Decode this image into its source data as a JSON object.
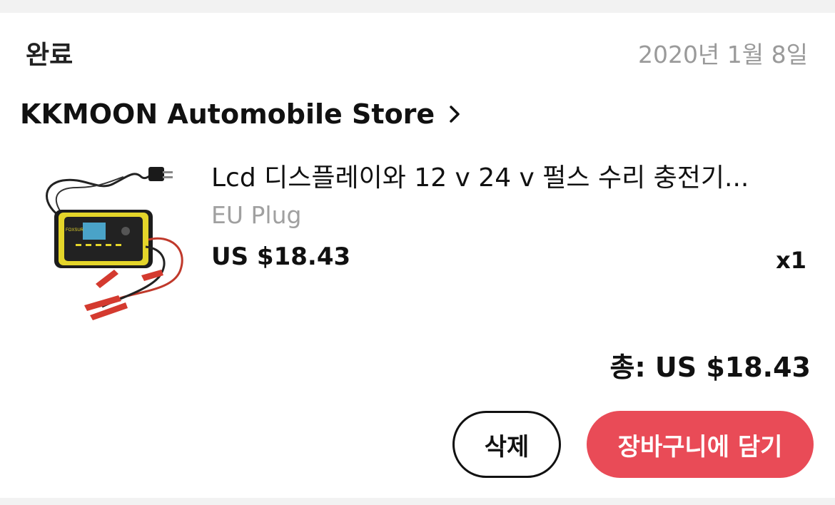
{
  "order": {
    "status": "완료",
    "date": "2020년 1월 8일"
  },
  "store": {
    "name": "KKMOON Automobile Store",
    "arrow_icon": "chevron-right-icon"
  },
  "item": {
    "title": "Lcd 디스플레이와 12 v 24 v 펄스 수리 충전기...",
    "variant": "EU Plug",
    "price": "US $18.43",
    "quantity": "x1",
    "image_brand_text": "FOXSUR"
  },
  "summary": {
    "total": "총: US $18.43"
  },
  "actions": {
    "delete_label": "삭제",
    "add_to_cart_label": "장바구니에 담기"
  },
  "colors": {
    "accent": "#e94b57",
    "muted_text": "#9a9a9a",
    "background": "#f2f2f2"
  }
}
